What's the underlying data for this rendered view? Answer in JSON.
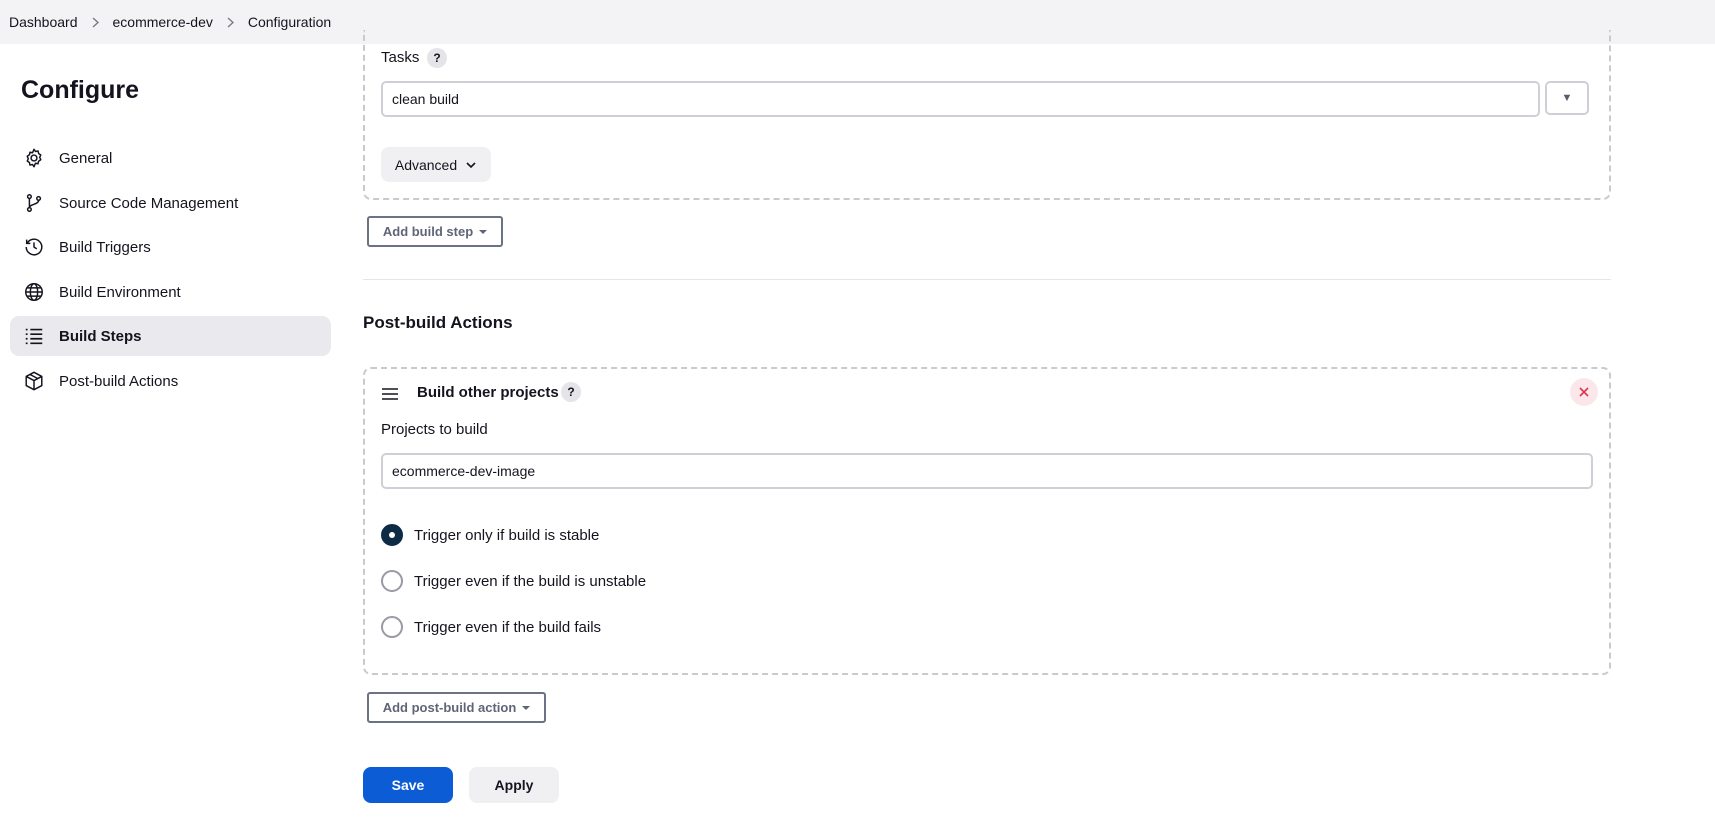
{
  "breadcrumb": {
    "items": [
      "Dashboard",
      "ecommerce-dev",
      "Configuration"
    ]
  },
  "sidebar": {
    "title": "Configure",
    "items": [
      {
        "label": "General",
        "icon": "gear-icon"
      },
      {
        "label": "Source Code Management",
        "icon": "branch-icon"
      },
      {
        "label": "Build Triggers",
        "icon": "clock-icon"
      },
      {
        "label": "Build Environment",
        "icon": "globe-icon"
      },
      {
        "label": "Build Steps",
        "icon": "list-icon",
        "active": true
      },
      {
        "label": "Post-build Actions",
        "icon": "package-icon"
      }
    ]
  },
  "build_step": {
    "tasks_label": "Tasks",
    "help": "?",
    "tasks_value": "clean build",
    "expand_glyph": "▼",
    "advanced_label": "Advanced",
    "add_build_step_label": "Add build step"
  },
  "post_build": {
    "section_title": "Post-build Actions",
    "step_title": "Build other projects",
    "help": "?",
    "projects_label": "Projects to build",
    "projects_value": "ecommerce-dev-image",
    "options": [
      {
        "label": "Trigger only if build is stable",
        "checked": true
      },
      {
        "label": "Trigger even if the build is unstable",
        "checked": false
      },
      {
        "label": "Trigger even if the build fails",
        "checked": false
      }
    ],
    "add_post_build_label": "Add post-build action"
  },
  "footer": {
    "save_label": "Save",
    "apply_label": "Apply"
  },
  "colors": {
    "primary": "#0b5cd5",
    "radio_checked": "#0e2b45",
    "close_bg": "#fbe7ea",
    "close_icon": "#d33a4f"
  }
}
